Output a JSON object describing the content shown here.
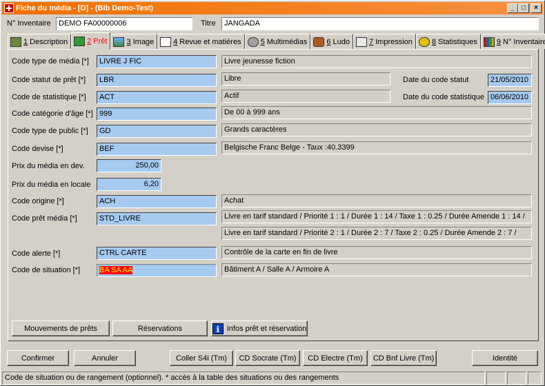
{
  "window": {
    "title": "Fiche du média - [D] - (Bib Demo-Test)",
    "accent": "#f07000"
  },
  "header": {
    "inventaire_label": "N° Inventaire",
    "inventaire_value": "DEMO FA00000006",
    "titre_label": "Titre",
    "titre_value": "JANGADA"
  },
  "tabs": [
    {
      "num": "1",
      "label": "Description",
      "icon": "book-icon"
    },
    {
      "num": "2",
      "label": "Prêt",
      "icon": "loan-icon"
    },
    {
      "num": "3",
      "label": "Image",
      "icon": "image-icon"
    },
    {
      "num": "4",
      "label": "Revue et matières",
      "icon": "edit-icon"
    },
    {
      "num": "5",
      "label": "Multimédias",
      "icon": "multimedia-icon"
    },
    {
      "num": "6",
      "label": "Ludo",
      "icon": "game-icon"
    },
    {
      "num": "7",
      "label": "Impression",
      "icon": "print-icon"
    },
    {
      "num": "8",
      "label": "Statistiques",
      "icon": "statistics-icon"
    },
    {
      "num": "9",
      "label": "N° Inventaire",
      "icon": "inventory-icon"
    }
  ],
  "form": {
    "type_media": {
      "label": "Code type de média [*]",
      "code": "LIVRE J FIC",
      "desc": "Livre jeunesse fiction"
    },
    "statut_pret": {
      "label": "Code statut de prêt [*]",
      "code": "LBR",
      "desc": "Libre",
      "date_label": "Date du code statut",
      "date": "21/05/2010"
    },
    "statistique": {
      "label": "Code de statistique [*]",
      "code": "ACT",
      "desc": "Actif",
      "date_label": "Date du code statistique",
      "date": "06/06/2010"
    },
    "categorie_age": {
      "label": "Code catégorie d'âge [*]",
      "code": "999",
      "desc": "De 00 à 999 ans"
    },
    "type_public": {
      "label": "Code type de public [*]",
      "code": "GD",
      "desc": "Grands caractères"
    },
    "devise": {
      "label": "Code devise [*]",
      "code": "BEF",
      "desc": "Belgische Franc Belge - Taux :40.3399"
    },
    "prix_devise": {
      "label": "Prix du média en dev.",
      "value": "250,00"
    },
    "prix_locale": {
      "label": "Prix du média en locale",
      "value": "6,20"
    },
    "origine": {
      "label": "Code origine [*]",
      "code": "ACH",
      "desc": "Achat"
    },
    "pret_media": {
      "label": "Code prêt média [*]",
      "code": "STD_LIVRE",
      "desc1": "Livre en tarif standard / Priorité 1 : 1 / Durée 1 : 14 / Taxe 1 : 0.25 / Durée Amende 1 : 14 /",
      "desc2": "Livre en tarif standard / Priorité 2 : 1 / Durée 2 : 7 / Taxe 2 : 0.25 / Durée Amende 2 : 7 /"
    },
    "alerte": {
      "label": "Code alerte [*]",
      "code": "CTRL CARTE",
      "desc": "Contrôle de la carte en fin de livre"
    },
    "situation": {
      "label": "Code de situation [*]",
      "code": "BA SA AA",
      "desc": "Bâtiment A / Salle A / Armoire A"
    }
  },
  "panel_buttons": {
    "mouvements": "Mouvements de prêts",
    "reservations": "Réservations",
    "infos": "Infos prêt et réservation"
  },
  "footer_buttons": {
    "confirmer": "Confirmer",
    "annuler": "Annuler",
    "coller": "Coller S4i (Tm)",
    "socrate": "CD Socrate (Tm)",
    "electre": "CD Electre (Tm)",
    "bnf": "CD Bnf Livre (Tm)",
    "identite": "Identité"
  },
  "status": {
    "text": "Code de situation ou de rangement (optionnel). * accès à la table des situations ou des rangements"
  }
}
